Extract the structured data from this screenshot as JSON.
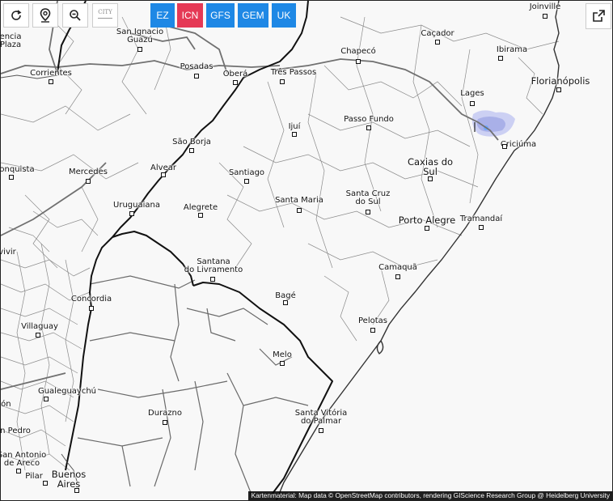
{
  "controls": {
    "refresh_icon": "refresh-icon",
    "location_icon": "location-pin-icon",
    "zoom_out_icon": "zoom-out-icon",
    "city_toggle_label": "CITY",
    "share_icon": "share-icon"
  },
  "models": [
    {
      "label": "EZ",
      "color": "#1e88e5",
      "active": false
    },
    {
      "label": "ICN",
      "color": "#e53955",
      "active": true
    },
    {
      "label": "GFS",
      "color": "#1e88e5",
      "active": false
    },
    {
      "label": "GEM",
      "color": "#1e88e5",
      "active": false
    },
    {
      "label": "UK",
      "color": "#1e88e5",
      "active": false
    }
  ],
  "cities": [
    {
      "name": "Joinville",
      "dot": "below"
    },
    {
      "name": "San Ignacio Guazú",
      "dot": "below"
    },
    {
      "name": "Caçador",
      "dot": "below"
    },
    {
      "name": "encia Plaza",
      "dot": "none"
    },
    {
      "name": "Chapecó",
      "dot": "below"
    },
    {
      "name": "Ibirama",
      "dot": "below"
    },
    {
      "name": "Posadas",
      "dot": "below"
    },
    {
      "name": "Oberá",
      "dot": "below"
    },
    {
      "name": "Três Passos",
      "dot": "below"
    },
    {
      "name": "Corrientes",
      "dot": "below"
    },
    {
      "name": "Florianópolis",
      "dot": "below",
      "big": true
    },
    {
      "name": "Lages",
      "dot": "below"
    },
    {
      "name": "Passo Fundo",
      "dot": "below"
    },
    {
      "name": "Ijuí",
      "dot": "below"
    },
    {
      "name": "São Borja",
      "dot": "below"
    },
    {
      "name": "Criciúma",
      "dot": "left"
    },
    {
      "name": "Caxias do Sul",
      "dot": "below",
      "big": true
    },
    {
      "name": "Alvear",
      "dot": "below"
    },
    {
      "name": "onquista",
      "dot": "below"
    },
    {
      "name": "Mercedes",
      "dot": "below"
    },
    {
      "name": "Santiago",
      "dot": "below"
    },
    {
      "name": "Santa Cruz do Sul",
      "dot": "below"
    },
    {
      "name": "Santa Maria",
      "dot": "below"
    },
    {
      "name": "Uruguaiana",
      "dot": "below"
    },
    {
      "name": "Alegrete",
      "dot": "below"
    },
    {
      "name": "Porto Alegre",
      "dot": "below",
      "big": true
    },
    {
      "name": "Tramandaí",
      "dot": "below"
    },
    {
      "name": "vivir",
      "dot": "none"
    },
    {
      "name": "Santana do Livramento",
      "dot": "below"
    },
    {
      "name": "Camaquã",
      "dot": "below"
    },
    {
      "name": "Bagé",
      "dot": "below"
    },
    {
      "name": "Concordia",
      "dot": "below"
    },
    {
      "name": "Pelotas",
      "dot": "below"
    },
    {
      "name": "Villaguay",
      "dot": "below"
    },
    {
      "name": "Melo",
      "dot": "below"
    },
    {
      "name": "Gualeguaychú",
      "dot": "below"
    },
    {
      "name": "ión",
      "dot": "none"
    },
    {
      "name": "Durazno",
      "dot": "below"
    },
    {
      "name": "Santa Vitória do Palmar",
      "dot": "below"
    },
    {
      "name": "n Pedro",
      "dot": "none"
    },
    {
      "name": "San Antonio de Areco",
      "dot": "below"
    },
    {
      "name": "Pilar",
      "dot": "below"
    },
    {
      "name": "Buenos Aires",
      "dot": "below",
      "big": true
    }
  ],
  "attribution": "Kartenmaterial: Map data © OpenStreetMap contributors, rendering GIScience Research Group @ Heidelberg University"
}
